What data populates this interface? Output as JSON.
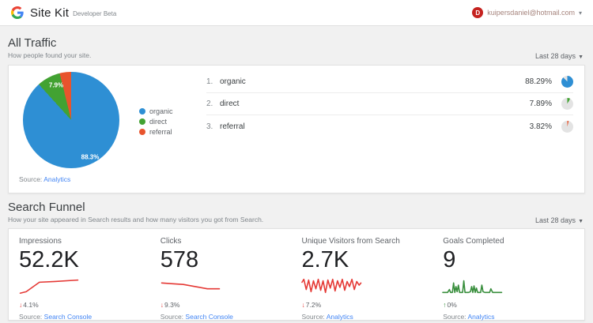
{
  "header": {
    "product_name": "Site Kit",
    "badge": "Developer Beta",
    "user_email": "kuipersdaniel@hotmail.com",
    "avatar_letter": "D"
  },
  "sections": {
    "all_traffic": {
      "title": "All Traffic",
      "subtitle": "How people found your site.",
      "date_range": "Last 28 days",
      "source_prefix": "Source:",
      "source_link": "Analytics",
      "rows": [
        {
          "rank": "1.",
          "label": "organic",
          "percent": "88.29%"
        },
        {
          "rank": "2.",
          "label": "direct",
          "percent": "7.89%"
        },
        {
          "rank": "3.",
          "label": "referral",
          "percent": "3.82%"
        }
      ]
    },
    "search_funnel": {
      "title": "Search Funnel",
      "subtitle": "How your site appeared in Search results and how many visitors you got from Search.",
      "date_range": "Last 28 days",
      "metrics": [
        {
          "label": "Impressions",
          "value": "52.2K",
          "change": "4.1%",
          "direction": "down",
          "source_prefix": "Source:",
          "source_link": "Search Console"
        },
        {
          "label": "Clicks",
          "value": "578",
          "change": "9.3%",
          "direction": "down",
          "source_prefix": "Source:",
          "source_link": "Search Console"
        },
        {
          "label": "Unique Visitors from Search",
          "value": "2.7K",
          "change": "7.2%",
          "direction": "down",
          "source_prefix": "Source:",
          "source_link": "Analytics"
        },
        {
          "label": "Goals Completed",
          "value": "9",
          "change": "0%",
          "direction": "up",
          "source_prefix": "Source:",
          "source_link": "Analytics"
        }
      ]
    }
  },
  "colors": {
    "link_blue": "#4285f4",
    "negative_red": "#e53935",
    "positive_green": "#388e3c",
    "avatar_red": "#c5221f"
  },
  "chart_data": [
    {
      "type": "pie",
      "title": "All Traffic",
      "labels": [
        "organic",
        "direct",
        "referral"
      ],
      "values": [
        88.29,
        7.89,
        3.82
      ],
      "colors": [
        "#2e8fd4",
        "#42a232",
        "#e8542d"
      ],
      "slice_labels": [
        "88.3%",
        "7.9%",
        ""
      ],
      "legend_position": "right",
      "source": "Analytics"
    },
    {
      "type": "line",
      "title": "Impressions trend (last 28 days)",
      "color": "#e53935",
      "trend": "down 4.1%",
      "points": [
        [
          2,
          23
        ],
        [
          12,
          21
        ],
        [
          34,
          8
        ],
        [
          60,
          7
        ],
        [
          98,
          5
        ]
      ]
    },
    {
      "type": "line",
      "title": "Clicks trend (last 28 days)",
      "color": "#e53935",
      "trend": "down 9.3%",
      "points": [
        [
          2,
          9
        ],
        [
          18,
          10
        ],
        [
          38,
          11
        ],
        [
          58,
          14
        ],
        [
          78,
          17
        ],
        [
          98,
          17
        ]
      ]
    },
    {
      "type": "line",
      "title": "Unique Visitors from Search trend (last 28 days)",
      "color": "#e53935",
      "trend": "down 7.2%",
      "points": [
        [
          0,
          8
        ],
        [
          3,
          4
        ],
        [
          7,
          18
        ],
        [
          11,
          5
        ],
        [
          15,
          21
        ],
        [
          19,
          6
        ],
        [
          23,
          17
        ],
        [
          27,
          4
        ],
        [
          31,
          19
        ],
        [
          35,
          6
        ],
        [
          39,
          22
        ],
        [
          43,
          5
        ],
        [
          47,
          16
        ],
        [
          51,
          4
        ],
        [
          55,
          20
        ],
        [
          59,
          6
        ],
        [
          63,
          15
        ],
        [
          67,
          4
        ],
        [
          71,
          19
        ],
        [
          75,
          7
        ],
        [
          79,
          14
        ],
        [
          83,
          4
        ],
        [
          87,
          18
        ],
        [
          91,
          7
        ],
        [
          95,
          12
        ],
        [
          98,
          9
        ]
      ]
    },
    {
      "type": "line",
      "title": "Goals Completed trend (last 28 days)",
      "color": "#388e3c",
      "trend": "up 0%",
      "points": [
        [
          0,
          22
        ],
        [
          8,
          22
        ],
        [
          11,
          18
        ],
        [
          13,
          22
        ],
        [
          16,
          22
        ],
        [
          18,
          9
        ],
        [
          20,
          22
        ],
        [
          22,
          14
        ],
        [
          24,
          21
        ],
        [
          26,
          12
        ],
        [
          28,
          22
        ],
        [
          33,
          22
        ],
        [
          35,
          6
        ],
        [
          37,
          22
        ],
        [
          43,
          22
        ],
        [
          46,
          21
        ],
        [
          48,
          14
        ],
        [
          50,
          22
        ],
        [
          52,
          13
        ],
        [
          54,
          22
        ],
        [
          56,
          16
        ],
        [
          58,
          22
        ],
        [
          63,
          22
        ],
        [
          65,
          12
        ],
        [
          67,
          21
        ],
        [
          70,
          22
        ],
        [
          78,
          22
        ],
        [
          80,
          17
        ],
        [
          83,
          22
        ],
        [
          92,
          22
        ],
        [
          98,
          22
        ]
      ]
    }
  ]
}
